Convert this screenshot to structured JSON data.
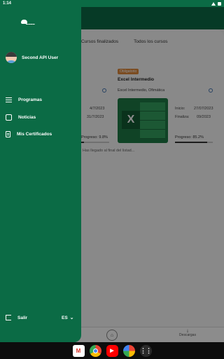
{
  "status_bar": {
    "time": "1:14"
  },
  "background": {
    "tabs": [
      "Cursos finalizados",
      "Todos los cursos"
    ],
    "card_right": {
      "badge": "Obligatorio",
      "title": "Excel Intermedio",
      "subtitle": "Excel Intermedio, Ofimática",
      "inicio_label": "Inicio:",
      "inicio_value": "27/07/2023",
      "finaliza_label": "Finaliza:",
      "finaliza_value": "09/2023",
      "progress_label": "Progreso: 85.2%",
      "progress": 0.852
    },
    "card_left": {
      "date1": "4/7/2023",
      "date2": "31/7/2023",
      "progress_label": "Progreso: 9.8%",
      "progress": 0.098
    },
    "end_message": "Has llegado al final del listad...",
    "bottom_nav": {
      "downloads_label": "Descargas"
    }
  },
  "drawer": {
    "user_name": "Second API User",
    "menu": [
      {
        "label": "Programas",
        "icon": "list-icon"
      },
      {
        "label": "Noticias",
        "icon": "chat-icon"
      },
      {
        "label": "Mis Certificados",
        "icon": "certificate-icon"
      }
    ],
    "logout_label": "Salir",
    "language": "ES"
  },
  "colors": {
    "primary": "#0b6b45",
    "badge": "#e08a3c"
  }
}
